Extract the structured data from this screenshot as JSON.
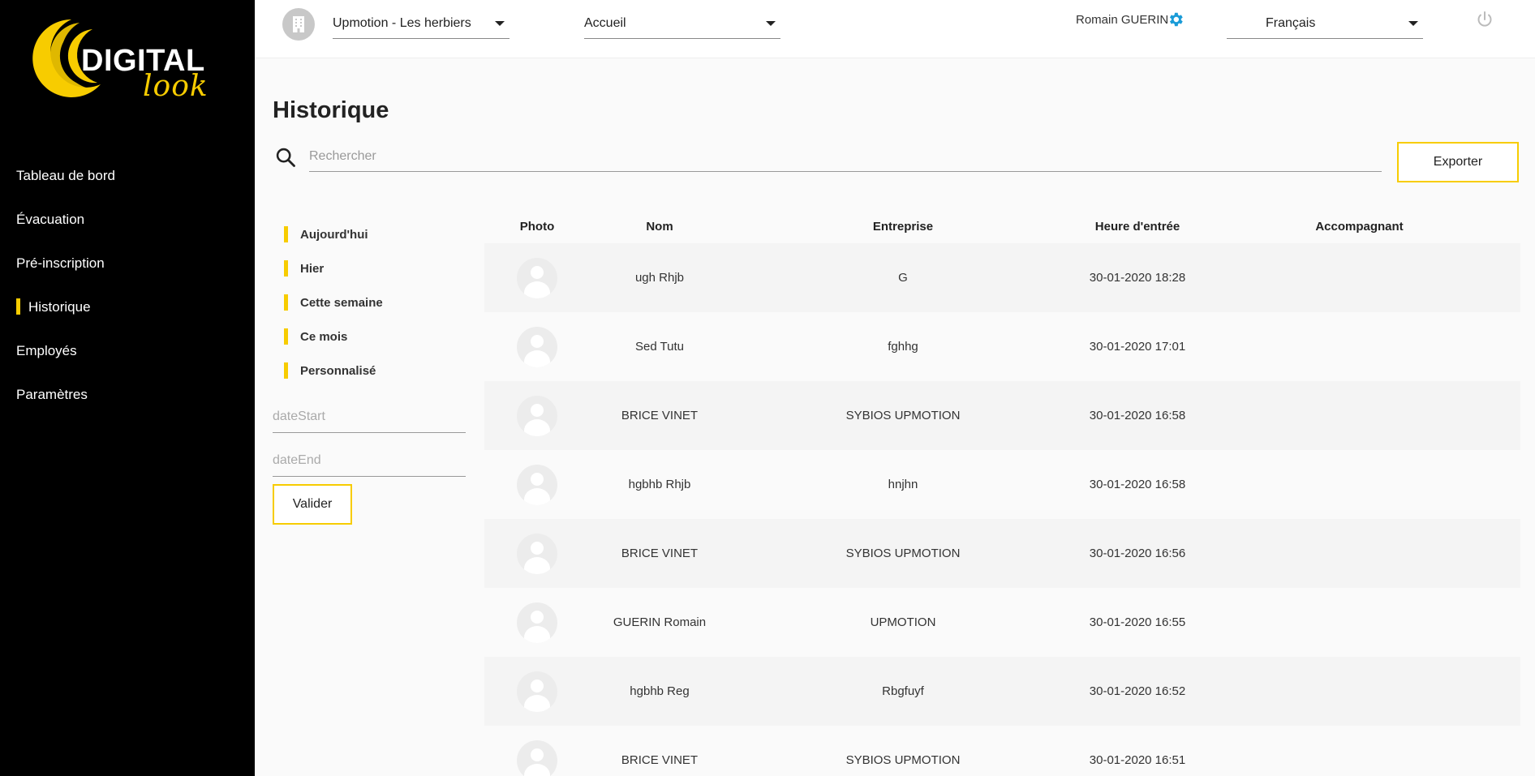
{
  "brand": {
    "logo_main": "DIGITAL",
    "logo_sub": "look"
  },
  "sidebar": {
    "items": [
      {
        "label": "Tableau de bord"
      },
      {
        "label": "Évacuation"
      },
      {
        "label": "Pré-inscription"
      },
      {
        "label": "Historique"
      },
      {
        "label": "Employés"
      },
      {
        "label": "Paramètres"
      }
    ]
  },
  "topbar": {
    "site_select": "Upmotion - Les herbiers",
    "page_select": "Accueil",
    "user_name": "Romain GUERIN",
    "language_select": "Français"
  },
  "main": {
    "title": "Historique",
    "search_placeholder": "Rechercher",
    "export_label": "Exporter",
    "filters": [
      "Aujourd'hui",
      "Hier",
      "Cette semaine",
      "Ce mois",
      "Personnalisé"
    ],
    "date_start_placeholder": "dateStart",
    "date_end_placeholder": "dateEnd",
    "validate_label": "Valider"
  },
  "table": {
    "headers": [
      "Photo",
      "Nom",
      "Entreprise",
      "Heure d'entrée",
      "Accompagnant"
    ],
    "rows": [
      {
        "nom": "ugh Rhjb",
        "entreprise": "G",
        "heure": "30-01-2020 18:28",
        "accompagnant": ""
      },
      {
        "nom": "Sed Tutu",
        "entreprise": "fghhg",
        "heure": "30-01-2020 17:01",
        "accompagnant": ""
      },
      {
        "nom": "BRICE VINET",
        "entreprise": "SYBIOS UPMOTION",
        "heure": "30-01-2020 16:58",
        "accompagnant": ""
      },
      {
        "nom": "hgbhb Rhjb",
        "entreprise": "hnjhn",
        "heure": "30-01-2020 16:58",
        "accompagnant": ""
      },
      {
        "nom": "BRICE VINET",
        "entreprise": "SYBIOS UPMOTION",
        "heure": "30-01-2020 16:56",
        "accompagnant": ""
      },
      {
        "nom": "GUERIN Romain",
        "entreprise": "UPMOTION",
        "heure": "30-01-2020 16:55",
        "accompagnant": ""
      },
      {
        "nom": "hgbhb Reg",
        "entreprise": "Rbgfuyf",
        "heure": "30-01-2020 16:52",
        "accompagnant": ""
      },
      {
        "nom": "BRICE VINET",
        "entreprise": "SYBIOS UPMOTION",
        "heure": "30-01-2020 16:51",
        "accompagnant": ""
      }
    ]
  },
  "colors": {
    "accent": "#f7cc00",
    "sidebar_bg": "#000000",
    "gear": "#1a9bd7"
  },
  "icons": [
    "building-icon",
    "chevron-down-icon",
    "gear-icon",
    "power-icon",
    "search-icon",
    "avatar-placeholder-icon"
  ]
}
